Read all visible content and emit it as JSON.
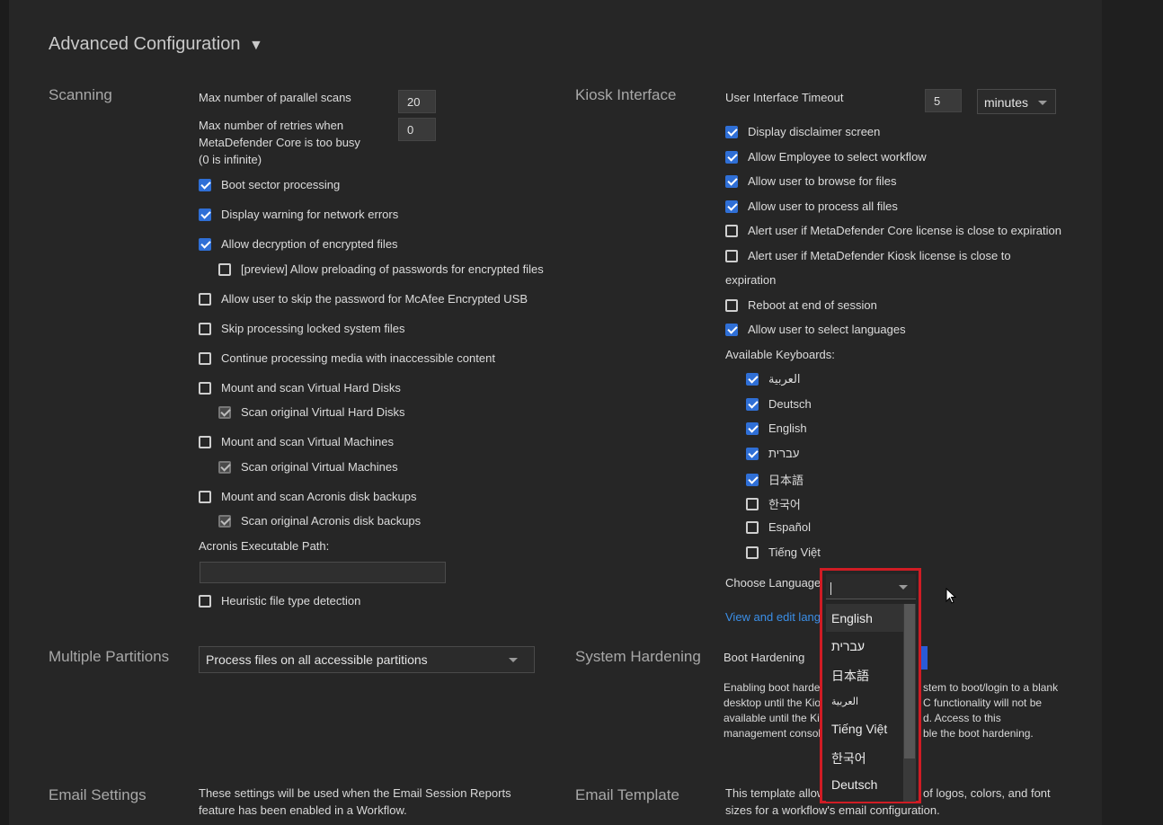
{
  "title": "Advanced Configuration",
  "title_caret": "▼",
  "scanning": {
    "title": "Scanning",
    "max_parallel_label": "Max number of parallel scans",
    "max_parallel_value": "20",
    "max_retries_label": [
      "Max number of retries when",
      "MetaDefender Core is too busy",
      "(0 is infinite)"
    ],
    "max_retries_value": "0",
    "options": [
      {
        "label": "Boot sector processing",
        "checked": true
      },
      {
        "label": "Display warning for network errors",
        "checked": true
      },
      {
        "label": "Allow decryption of encrypted files",
        "checked": true
      },
      {
        "label": "[preview] Allow preloading of passwords for encrypted files",
        "checked": false
      },
      {
        "label": "Allow user to skip the password for McAfee Encrypted USB",
        "checked": false
      },
      {
        "label": "Skip processing locked system files",
        "checked": false
      },
      {
        "label": "Continue processing media with inaccessible content",
        "checked": false
      },
      {
        "label": "Mount and scan Virtual Hard Disks",
        "checked": false
      },
      {
        "label": "Scan original Virtual Hard Disks",
        "checked": true
      },
      {
        "label": "Mount and scan Virtual Machines",
        "checked": false
      },
      {
        "label": "Scan original Virtual Machines",
        "checked": true
      },
      {
        "label": "Mount and scan Acronis disk backups",
        "checked": false
      },
      {
        "label": "Scan original Acronis disk backups",
        "checked": true
      },
      {
        "label": "Heuristic file type detection",
        "checked": false
      }
    ],
    "acronis_path_label": "Acronis Executable Path:",
    "acronis_path_value": ""
  },
  "kiosk": {
    "title": "Kiosk Interface",
    "timeout_label": "User Interface Timeout",
    "timeout_value": "5",
    "timeout_unit": "minutes",
    "options": [
      {
        "label": "Display disclaimer screen",
        "checked": true
      },
      {
        "label": "Allow Employee to select workflow",
        "checked": true
      },
      {
        "label": "Allow user to browse for files",
        "checked": true
      },
      {
        "label": "Allow user to process all files",
        "checked": true
      },
      {
        "label": "Alert user if MetaDefender Core license is close to expiration",
        "checked": false
      },
      {
        "label": "Alert user if MetaDefender Kiosk license is close to",
        "checked": false
      },
      {
        "label": "Reboot at end of session",
        "checked": false
      },
      {
        "label": "Allow user to select languages",
        "checked": true
      }
    ],
    "kiosk_license_wrap": "expiration",
    "keyboards_label": "Available Keyboards:",
    "keyboards": [
      {
        "label": "العربية",
        "checked": true
      },
      {
        "label": "Deutsch",
        "checked": true
      },
      {
        "label": "English",
        "checked": true
      },
      {
        "label": "עברית",
        "checked": true
      },
      {
        "label": "日本語",
        "checked": true
      },
      {
        "label": "한국어",
        "checked": false
      },
      {
        "label": "Español",
        "checked": false
      },
      {
        "label": "Tiếng Việt",
        "checked": false
      }
    ],
    "choose_language_label": "Choose Language",
    "choose_language_value": "",
    "view_edit_link": "View and edit langu"
  },
  "language_dropdown": {
    "items": [
      "English",
      "עברית",
      "日本語",
      "العربية",
      "Tiếng Việt",
      "한국어",
      "Deutsch"
    ]
  },
  "partitions": {
    "title": "Multiple Partitions",
    "value": "Process files on all accessible partitions"
  },
  "hardening": {
    "title": "System Hardening",
    "boot_label": "Boot Hardening",
    "desc_lines": [
      "Enabling boot harden",
      "desktop until the Kio",
      "available until the Ki",
      "management consol"
    ],
    "desc_right_lines": [
      "stem to boot/login to a blank",
      "C functionality will not be",
      "d. Access to this",
      "ble the boot hardening."
    ]
  },
  "email_settings": {
    "title": "Email Settings",
    "desc_lines": [
      "These settings will be used when the Email Session Reports",
      "feature has been enabled in a Workflow."
    ]
  },
  "email_template": {
    "title": "Email Template",
    "desc_left": [
      "This template allow",
      "sizes for a workflow's email configuration."
    ],
    "desc_right": "of logos, colors, and font"
  },
  "colors": {
    "accent": "#2f6fd6",
    "highlight": "#d01c24",
    "link": "#3b8fe8"
  }
}
